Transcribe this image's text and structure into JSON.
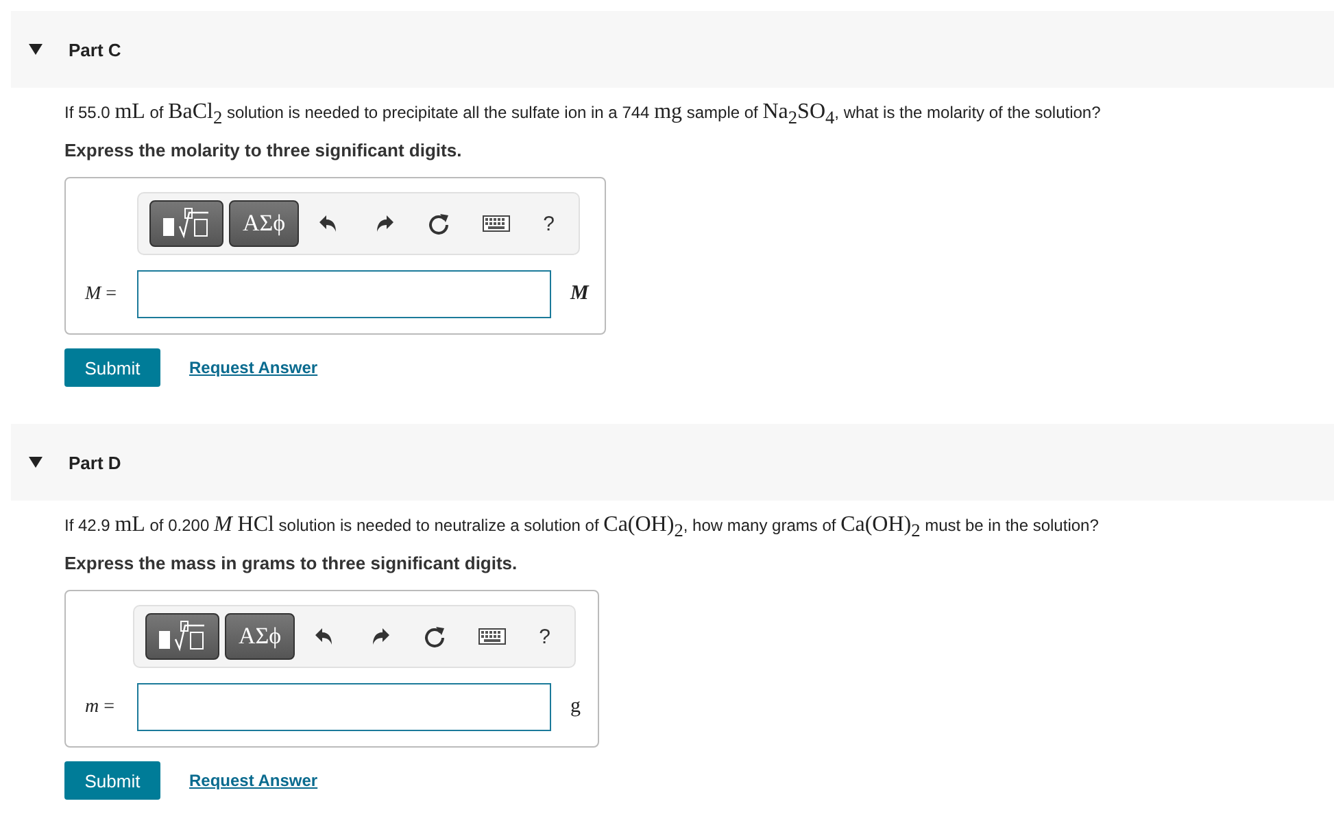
{
  "parts": [
    {
      "title": "Part C",
      "expanded": true,
      "question": [
        {
          "kind": "text",
          "text": "If 55.0 "
        },
        {
          "kind": "math",
          "text": "mL"
        },
        {
          "kind": "text",
          "text": " of "
        },
        {
          "kind": "math",
          "text": "BaCl$_{2}$"
        },
        {
          "kind": "text",
          "text": " solution is needed to precipitate all the sulfate ion in a 744 "
        },
        {
          "kind": "math",
          "text": "mg"
        },
        {
          "kind": "text",
          "text": " sample of "
        },
        {
          "kind": "math",
          "text": "Na$_{2}$SO$_{4}$"
        },
        {
          "kind": "text",
          "text": ", what is the molarity of the solution?"
        }
      ],
      "instruction": "Express the molarity to three significant digits.",
      "toolbar": {
        "greek": "ΑΣϕ",
        "help": "?"
      },
      "answer": {
        "variable": "M",
        "equals": "=",
        "unit": "M",
        "unit_italic": true
      },
      "submit": "Submit",
      "request": "Request Answer"
    },
    {
      "title": "Part D",
      "expanded": true,
      "question": [
        {
          "kind": "text",
          "text": "If 42.9 "
        },
        {
          "kind": "math",
          "text": "mL"
        },
        {
          "kind": "text",
          "text": " of 0.200 "
        },
        {
          "kind": "math",
          "text": "*M*"
        },
        {
          "kind": "math",
          "text": " HCl"
        },
        {
          "kind": "text",
          "text": " solution is needed to neutralize a solution of "
        },
        {
          "kind": "math",
          "text": "Ca(OH)$_{2}$"
        },
        {
          "kind": "text",
          "text": ", how many grams of "
        },
        {
          "kind": "math",
          "text": "Ca(OH)$_{2}$"
        },
        {
          "kind": "text",
          "text": " must be in the solution?"
        }
      ],
      "instruction": "Express the mass in grams to three significant digits.",
      "toolbar": {
        "greek": "ΑΣϕ",
        "help": "?"
      },
      "answer": {
        "variable": "m",
        "equals": "=",
        "unit": "g",
        "unit_italic": false
      },
      "submit": "Submit",
      "request": "Request Answer"
    }
  ]
}
